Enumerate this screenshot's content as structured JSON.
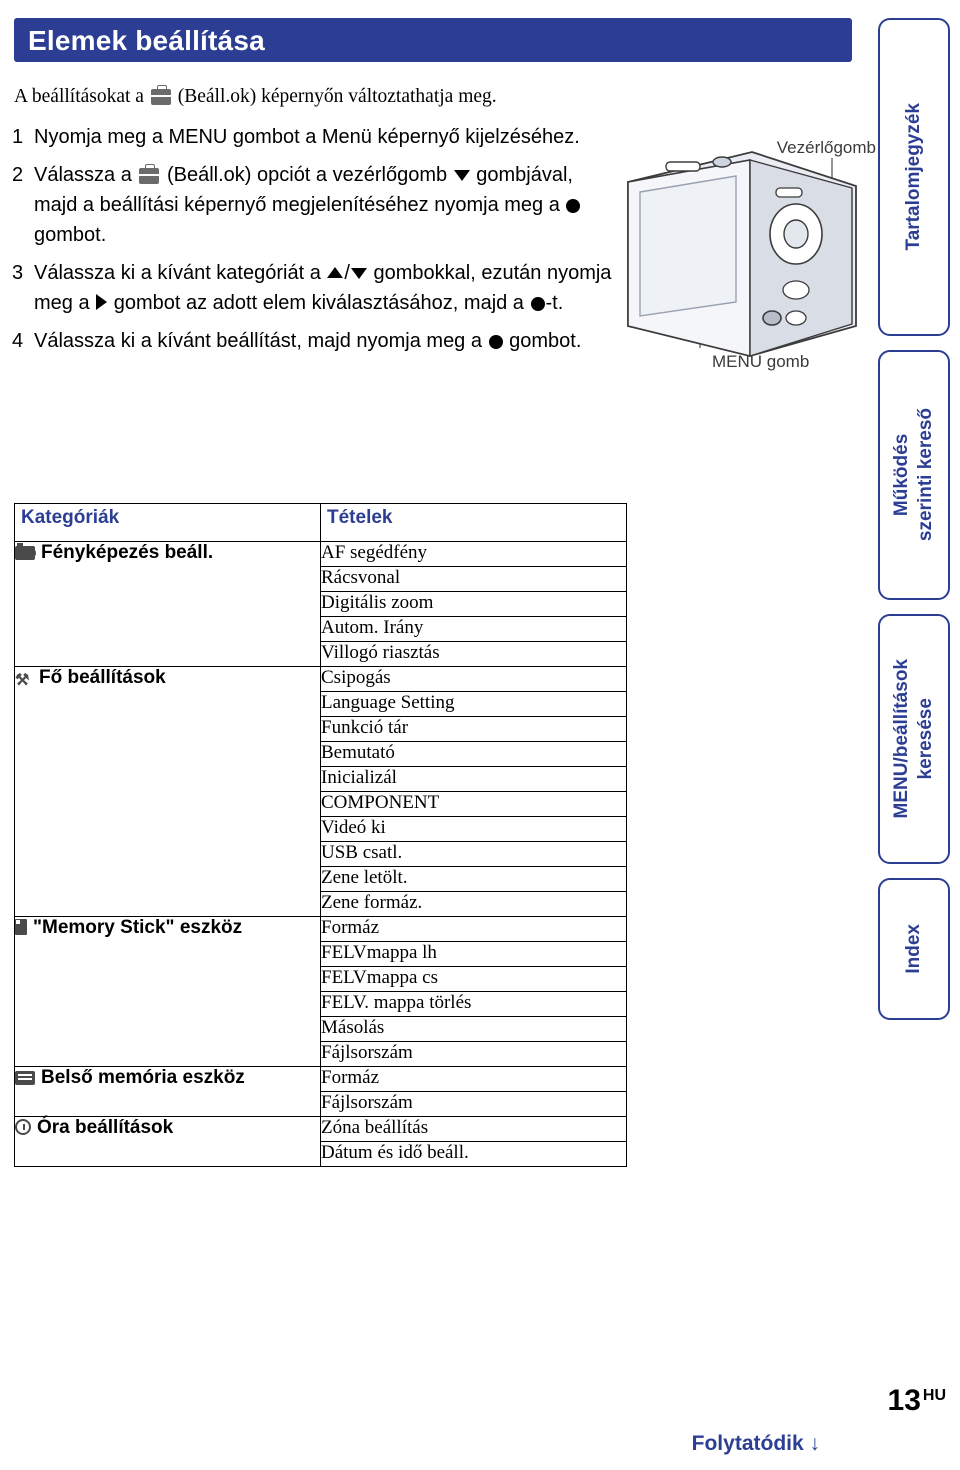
{
  "title": "Elemek beállítása",
  "intro": {
    "before": "A beállításokat a",
    "after": "(Beáll.ok) képernyőn változtathatja meg."
  },
  "steps": [
    {
      "num": "1",
      "text": "Nyomja meg a MENU gombot a Menü képernyő kijelzéséhez."
    },
    {
      "num": "2",
      "text_a": "Válassza a",
      "text_b": "(Beáll.ok) opciót a vezérlőgomb",
      "text_c": "gombjával, majd a beállítási képernyő megjelenítéséhez nyomja meg a",
      "text_d": "gombot."
    },
    {
      "num": "3",
      "text_a": "Válassza ki a kívánt kategóriát a",
      "text_b": "/",
      "text_c": "gombokkal, ezután nyomja meg a",
      "text_d": "gombot az adott elem kiválasztásához, majd a",
      "text_e": "-t."
    },
    {
      "num": "4",
      "text_a": "Válassza ki a kívánt beállítást, majd nyomja meg a",
      "text_b": "gombot."
    }
  ],
  "camera": {
    "label_control": "Vezérlőgomb",
    "label_menu": "MENU gomb"
  },
  "side_tabs": [
    {
      "label": "Tartalomjegyzék",
      "name": "tab-tartalomjegyzek"
    },
    {
      "label": "Működés\nszerinti kereső",
      "name": "tab-mukodes-szerinti-kereso"
    },
    {
      "label": "MENU/beállítások\nkeresése",
      "name": "tab-menu-beallitasok-keresese"
    },
    {
      "label": "Index",
      "name": "tab-index"
    }
  ],
  "table": {
    "header_categories": "Kategóriák",
    "header_items": "Tételek",
    "rows": [
      {
        "category": "Fényképezés beáll.",
        "icon": "camera-icon",
        "items": [
          "AF segédfény",
          "Rácsvonal",
          "Digitális zoom",
          "Autom. Irány",
          "Villogó riasztás"
        ]
      },
      {
        "category": "Fő beállítások",
        "icon": "wrench-icon",
        "items": [
          "Csipogás",
          "Language Setting",
          "Funkció tár",
          "Bemutató",
          "Inicializál",
          "COMPONENT",
          "Videó ki",
          "USB csatl.",
          "Zene letölt.",
          "Zene formáz."
        ]
      },
      {
        "category": "\"Memory Stick\" eszköz",
        "icon": "memory-stick-icon",
        "items": [
          "Formáz",
          "FELVmappa lh",
          "FELVmappa cs",
          "FELV. mappa törlés",
          "Másolás",
          "Fájlsorszám"
        ]
      },
      {
        "category": "Belső memória eszköz",
        "icon": "internal-memory-icon",
        "items": [
          "Formáz",
          "Fájlsorszám"
        ]
      },
      {
        "category": "Óra beállítások",
        "icon": "clock-icon",
        "items": [
          "Zóna beállítás",
          "Dátum és idő beáll."
        ]
      }
    ]
  },
  "footer": {
    "page_number": "13",
    "page_suffix": "HU",
    "continued": "Folytatódik ↓"
  },
  "colors": {
    "accent": "#2c3e94",
    "title_bg": "#2c3e94",
    "text": "#000000"
  }
}
